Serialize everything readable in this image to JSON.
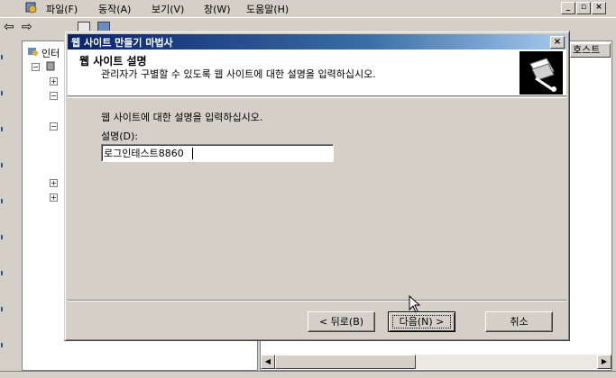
{
  "menubar": {
    "items": [
      "파일(F)",
      "동작(A)",
      "보기(V)",
      "창(W)",
      "도움말(H)"
    ],
    "mdi_controls": [
      "_",
      "▫",
      "×"
    ]
  },
  "right_pane": {
    "column_header": "호스트"
  },
  "tree": {
    "root_label": "인터"
  },
  "dialog": {
    "title": "웹 사이트 만들기 마법사",
    "close_symbol": "×",
    "header": {
      "title": "웹 사이트 설명",
      "subtitle": "관리자가 구별할 수 있도록 웹 사이트에 대한 설명을 입력하십시오."
    },
    "prompt": "웹 사이트에 대한 설명을 입력하십시오.",
    "field_label": "설명(D):",
    "description_value": "로그인테스트8860",
    "buttons": {
      "back": "< 뒤로(B)",
      "next": "다음(N) >",
      "cancel": "취소"
    }
  },
  "colors": {
    "title_gradient_start": "#0a246a",
    "title_gradient_end": "#a6caf0",
    "face": "#d4d0c8"
  },
  "icons": [
    "app-icon",
    "back-arrow-icon",
    "forward-arrow-icon",
    "wizard-icon",
    "mouse-cursor-icon"
  ]
}
